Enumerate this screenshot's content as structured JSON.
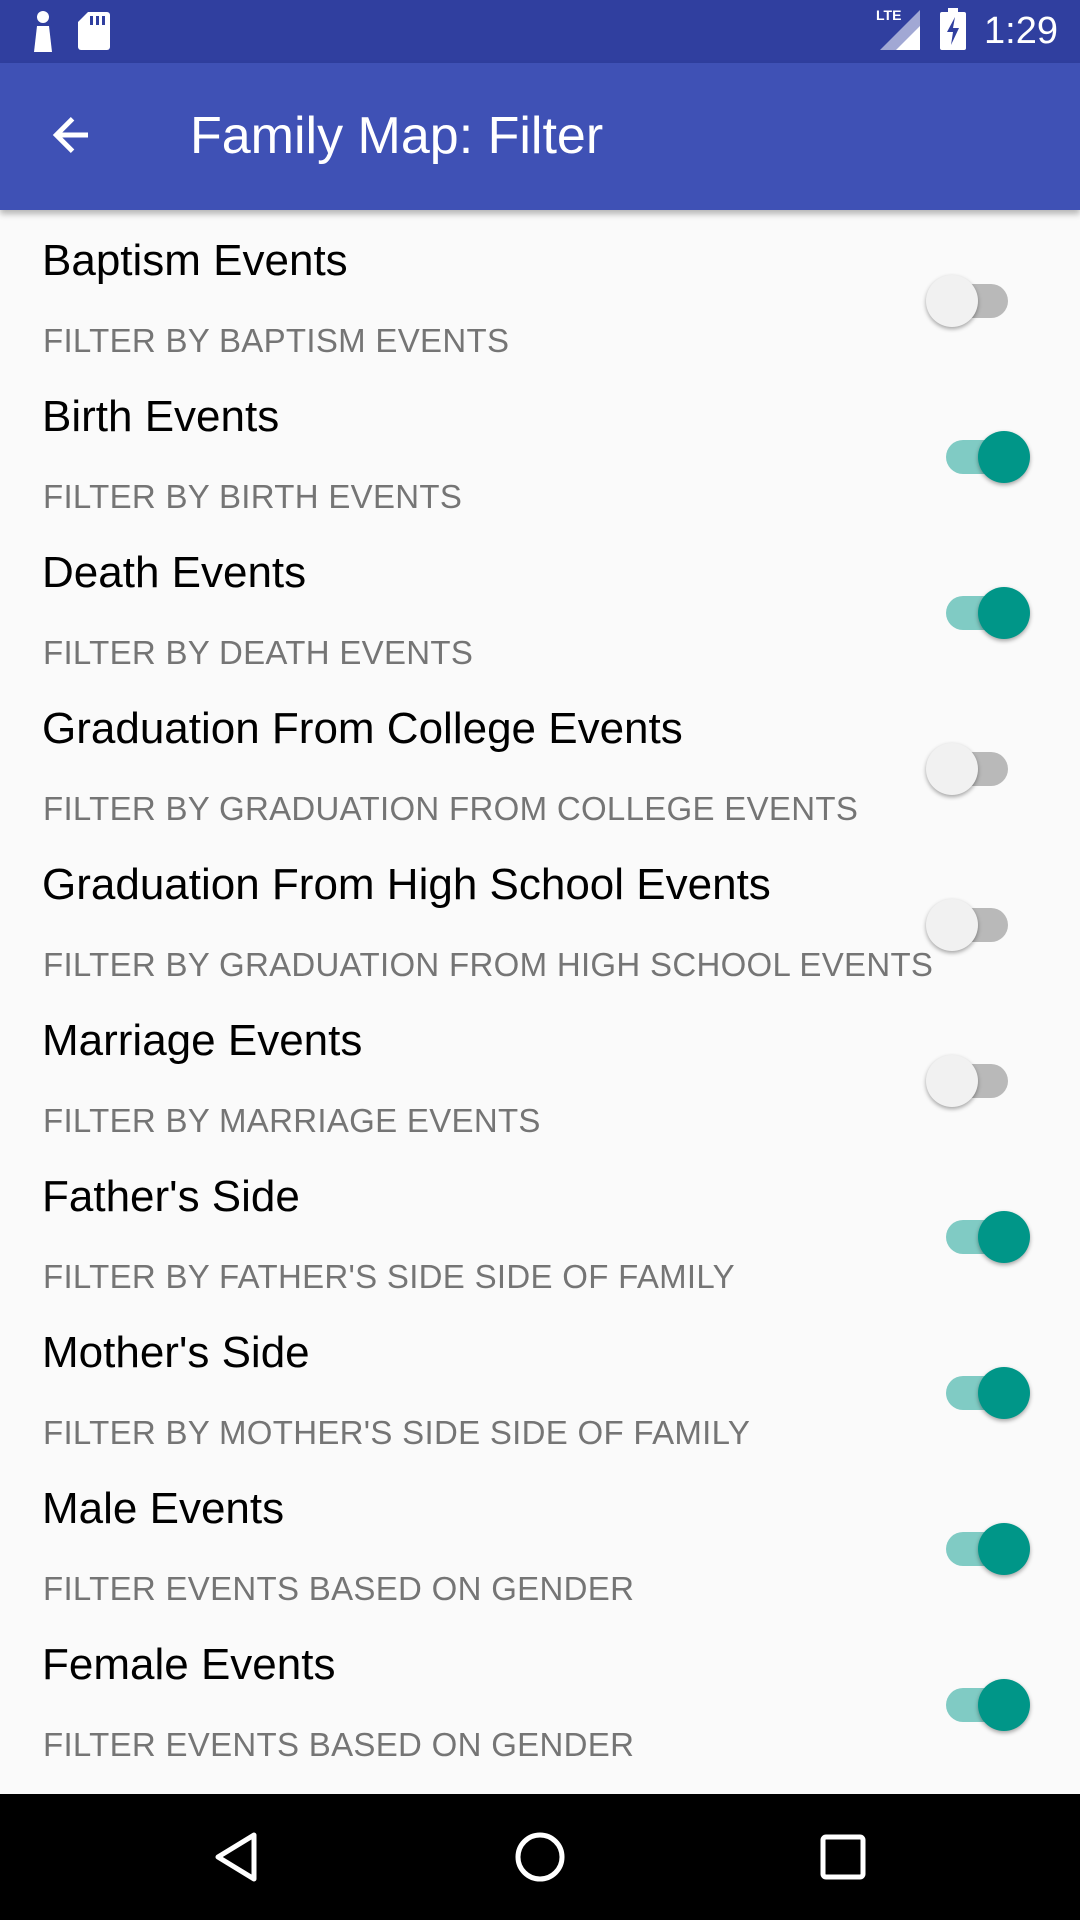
{
  "status_bar": {
    "time": "1:29",
    "network_label": "LTE",
    "icons": [
      "notification-icon",
      "sd-card-icon",
      "lte-signal-icon",
      "battery-charging-icon"
    ]
  },
  "app_bar": {
    "title": "Family Map: Filter",
    "back_icon": "arrow-back-icon"
  },
  "colors": {
    "status_bar": "#303f9f",
    "app_bar": "#3f51b5",
    "switch_on": "#009688",
    "switch_on_track": "#80cbc4",
    "switch_off_thumb": "#f1f1f1",
    "switch_off_track": "#b9b9b9",
    "subtitle_text": "#757575"
  },
  "filters": [
    {
      "title": "Baptism Events",
      "subtitle": "FILTER BY BAPTISM EVENTS",
      "enabled": false
    },
    {
      "title": "Birth Events",
      "subtitle": "FILTER BY BIRTH EVENTS",
      "enabled": true
    },
    {
      "title": "Death Events",
      "subtitle": "FILTER BY DEATH EVENTS",
      "enabled": true
    },
    {
      "title": "Graduation From College Events",
      "subtitle": "FILTER BY GRADUATION FROM COLLEGE EVENTS",
      "enabled": false
    },
    {
      "title": "Graduation From High School Events",
      "subtitle": "FILTER BY GRADUATION FROM HIGH SCHOOL EVENTS",
      "enabled": false
    },
    {
      "title": "Marriage Events",
      "subtitle": "FILTER BY MARRIAGE EVENTS",
      "enabled": false
    },
    {
      "title": "Father's Side",
      "subtitle": "FILTER BY FATHER'S SIDE SIDE OF FAMILY",
      "enabled": true
    },
    {
      "title": "Mother's Side",
      "subtitle": "FILTER BY MOTHER'S SIDE SIDE OF FAMILY",
      "enabled": true
    },
    {
      "title": "Male Events",
      "subtitle": "FILTER EVENTS BASED ON GENDER",
      "enabled": true
    },
    {
      "title": "Female Events",
      "subtitle": "FILTER EVENTS BASED ON GENDER",
      "enabled": true
    }
  ],
  "nav_bar": {
    "icons": [
      "back-triangle-icon",
      "home-circle-icon",
      "recents-square-icon"
    ]
  }
}
